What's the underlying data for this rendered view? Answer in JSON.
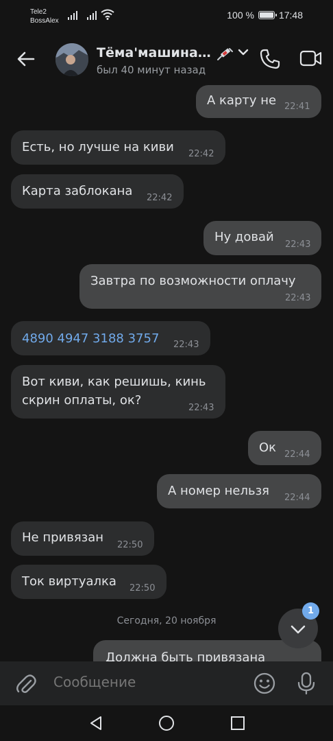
{
  "status_bar": {
    "carrier_line1": "Tele2",
    "carrier_line2": "BossAlex",
    "battery": "100 %",
    "battery_level": 1.0,
    "time": "17:48"
  },
  "header": {
    "contact_name": "Тёма'машина…",
    "last_seen": "был 40 минут назад",
    "icons": [
      "back-arrow-icon",
      "avatar",
      "syringe-icon",
      "chevron-down-icon",
      "phone-icon",
      "video-camera-icon"
    ]
  },
  "messages": [
    {
      "dir": "out",
      "text": "А карту не",
      "time": "22:41"
    },
    {
      "dir": "in",
      "text": "Есть, но лучше на киви",
      "time": "22:42"
    },
    {
      "dir": "in",
      "text": "Карта заблокана",
      "time": "22:42"
    },
    {
      "dir": "out",
      "text": "Ну довай",
      "time": "22:43"
    },
    {
      "dir": "out",
      "text": "Завтра по возможности оплачу",
      "time": "22:43"
    },
    {
      "dir": "in",
      "text": "4890 4947 3188 3757",
      "time": "22:43",
      "is_link": true
    },
    {
      "dir": "in",
      "text_line1": "Вот киви, как решишь, кинь",
      "text_line2": "скрин оплаты, ок?",
      "time": "22:43"
    },
    {
      "dir": "out",
      "text": "Ок",
      "time": "22:44"
    },
    {
      "dir": "out",
      "text": "А номер нельзя",
      "time": "22:44"
    },
    {
      "dir": "in",
      "text": "Не привязан",
      "time": "22:50"
    },
    {
      "dir": "in",
      "text": "Ток виртуалка",
      "time": "22:50"
    },
    {
      "dir": "out",
      "text": "Должна быть привязана",
      "time": ""
    }
  ],
  "date_separator": "Сегодня, 20 ноября",
  "scroll_down": {
    "unread_count": "1"
  },
  "composer": {
    "placeholder": "Сообщение"
  },
  "colors": {
    "background": "#141414",
    "incoming_bubble": "#2c2d2e",
    "outgoing_bubble": "#454647",
    "link": "#71aaeb",
    "badge": "#71aaeb",
    "composer_bg": "#222324"
  }
}
